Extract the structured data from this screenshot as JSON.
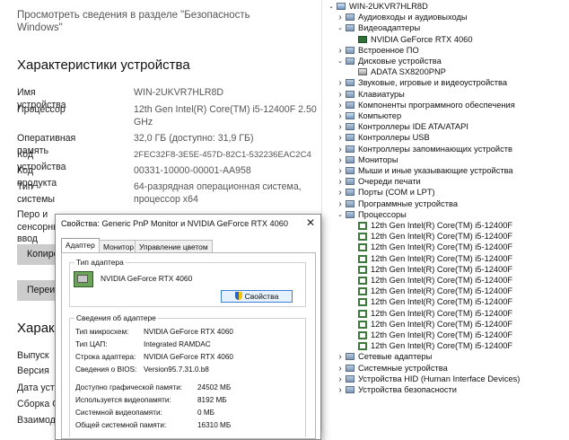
{
  "settings": {
    "security_link": "Просмотреть сведения в разделе \"Безопасность Windows\"",
    "device_specs_title": "Характеристики устройства",
    "specs": [
      {
        "label": "Имя устройства",
        "value": "WIN-2UKVR7HLR8D"
      },
      {
        "label": "Процессор",
        "value": "12th Gen Intel(R) Core(TM) i5-12400F 2.50 GHz"
      },
      {
        "label": "Оперативная память",
        "value": "32,0 ГБ (доступно: 31,9 ГБ)"
      },
      {
        "label": "Код устройства",
        "value": "2FEC32F8-3E5E-457D-82C1-532236EAC2C4"
      },
      {
        "label": "Код продукта",
        "value": "00331-10000-00001-AA958"
      },
      {
        "label": "Тип системы",
        "value": "64-разрядная операционная система, процессор x64"
      },
      {
        "label": "Перо и сенсорный ввод",
        "value": ""
      }
    ],
    "copy_button": "Копировать",
    "rename_button": "Переименовать",
    "windows_specs_title": "Характеристики",
    "windows_specs": [
      "Выпуск",
      "Версия",
      "Дата установки",
      "Сборка ОС",
      "Взаимодействие"
    ]
  },
  "devmgr": {
    "rows": [
      {
        "label": "WIN-2UKVR7HLR8D",
        "level": 0,
        "arrow": "v",
        "icon": "computer-icon"
      },
      {
        "label": "Аудиовходы и аудиовыходы",
        "level": 1,
        "arrow": ">",
        "icon": "audio-icon"
      },
      {
        "label": "Видеоадаптеры",
        "level": 1,
        "arrow": "v",
        "icon": "display-adapter-icon"
      },
      {
        "label": "NVIDIA GeForce RTX 4060",
        "level": 2,
        "arrow": "",
        "icon": "gpu-icon"
      },
      {
        "label": "Встроенное ПО",
        "level": 1,
        "arrow": ">",
        "icon": "firmware-icon"
      },
      {
        "label": "Дисковые устройства",
        "level": 1,
        "arrow": "v",
        "icon": "disk-drive-icon"
      },
      {
        "label": "ADATA SX8200PNP",
        "level": 2,
        "arrow": "",
        "icon": "disk-icon"
      },
      {
        "label": "Звуковые, игровые и видеоустройства",
        "level": 1,
        "arrow": ">",
        "icon": "sound-icon"
      },
      {
        "label": "Клавиатуры",
        "level": 1,
        "arrow": ">",
        "icon": "keyboard-icon"
      },
      {
        "label": "Компоненты программного обеспечения",
        "level": 1,
        "arrow": ">",
        "icon": "software-components-icon"
      },
      {
        "label": "Компьютер",
        "level": 1,
        "arrow": ">",
        "icon": "computer-icon"
      },
      {
        "label": "Контроллеры IDE ATA/ATAPI",
        "level": 1,
        "arrow": ">",
        "icon": "ide-controller-icon"
      },
      {
        "label": "Контроллеры USB",
        "level": 1,
        "arrow": ">",
        "icon": "usb-icon"
      },
      {
        "label": "Контроллеры запоминающих устройств",
        "level": 1,
        "arrow": ">",
        "icon": "storage-controller-icon"
      },
      {
        "label": "Мониторы",
        "level": 1,
        "arrow": ">",
        "icon": "monitor-icon"
      },
      {
        "label": "Мыши и иные указывающие устройства",
        "level": 1,
        "arrow": ">",
        "icon": "mouse-icon"
      },
      {
        "label": "Очереди печати",
        "level": 1,
        "arrow": ">",
        "icon": "printer-icon"
      },
      {
        "label": "Порты (COM и LPT)",
        "level": 1,
        "arrow": ">",
        "icon": "port-icon"
      },
      {
        "label": "Программные устройства",
        "level": 1,
        "arrow": ">",
        "icon": "software-device-icon"
      },
      {
        "label": "Процессоры",
        "level": 1,
        "arrow": "v",
        "icon": "processor-icon"
      },
      {
        "label": "12th Gen Intel(R) Core(TM) i5-12400F",
        "level": 2,
        "arrow": "",
        "icon": "cpu-icon"
      },
      {
        "label": "12th Gen Intel(R) Core(TM) i5-12400F",
        "level": 2,
        "arrow": "",
        "icon": "cpu-icon"
      },
      {
        "label": "12th Gen Intel(R) Core(TM) i5-12400F",
        "level": 2,
        "arrow": "",
        "icon": "cpu-icon"
      },
      {
        "label": "12th Gen Intel(R) Core(TM) i5-12400F",
        "level": 2,
        "arrow": "",
        "icon": "cpu-icon"
      },
      {
        "label": "12th Gen Intel(R) Core(TM) i5-12400F",
        "level": 2,
        "arrow": "",
        "icon": "cpu-icon"
      },
      {
        "label": "12th Gen Intel(R) Core(TM) i5-12400F",
        "level": 2,
        "arrow": "",
        "icon": "cpu-icon"
      },
      {
        "label": "12th Gen Intel(R) Core(TM) i5-12400F",
        "level": 2,
        "arrow": "",
        "icon": "cpu-icon"
      },
      {
        "label": "12th Gen Intel(R) Core(TM) i5-12400F",
        "level": 2,
        "arrow": "",
        "icon": "cpu-icon"
      },
      {
        "label": "12th Gen Intel(R) Core(TM) i5-12400F",
        "level": 2,
        "arrow": "",
        "icon": "cpu-icon"
      },
      {
        "label": "12th Gen Intel(R) Core(TM) i5-12400F",
        "level": 2,
        "arrow": "",
        "icon": "cpu-icon"
      },
      {
        "label": "12th Gen Intel(R) Core(TM) i5-12400F",
        "level": 2,
        "arrow": "",
        "icon": "cpu-icon"
      },
      {
        "label": "12th Gen Intel(R) Core(TM) i5-12400F",
        "level": 2,
        "arrow": "",
        "icon": "cpu-icon"
      },
      {
        "label": "Сетевые адаптеры",
        "level": 1,
        "arrow": ">",
        "icon": "network-adapter-icon"
      },
      {
        "label": "Системные устройства",
        "level": 1,
        "arrow": ">",
        "icon": "system-devices-icon"
      },
      {
        "label": "Устройства HID (Human Interface Devices)",
        "level": 1,
        "arrow": ">",
        "icon": "hid-icon"
      },
      {
        "label": "Устройства безопасности",
        "level": 1,
        "arrow": ">",
        "icon": "security-device-icon"
      }
    ]
  },
  "dialog": {
    "title": "Свойства: Generic PnP Monitor и NVIDIA GeForce RTX 4060",
    "close_glyph": "✕",
    "tabs": [
      "Адаптер",
      "Монитор",
      "Управление цветом"
    ],
    "adapter_type_caption": "Тип адаптера",
    "adapter_name": "NVIDIA GeForce RTX 4060",
    "properties_button": "Свойства",
    "adapter_info_caption": "Сведения об адаптере",
    "adapter_info": [
      {
        "k": "Тип микросхем:",
        "v": "NVIDIA GeForce RTX 4060"
      },
      {
        "k": "Тип ЦАП:",
        "v": "Integrated RAMDAC"
      },
      {
        "k": "Строка адаптера:",
        "v": "NVIDIA GeForce RTX 4060"
      },
      {
        "k": "Сведения о BIOS:",
        "v": "Version95.7.31.0.b8"
      }
    ],
    "memory_info": [
      {
        "k": "Доступно графической памяти:",
        "v": "24502 МБ"
      },
      {
        "k": "Используется видеопамяти:",
        "v": "8192 МБ"
      },
      {
        "k": "Системной видеопамяти:",
        "v": "0 МБ"
      },
      {
        "k": "Общей системной памяти:",
        "v": "16310 МБ"
      }
    ]
  }
}
